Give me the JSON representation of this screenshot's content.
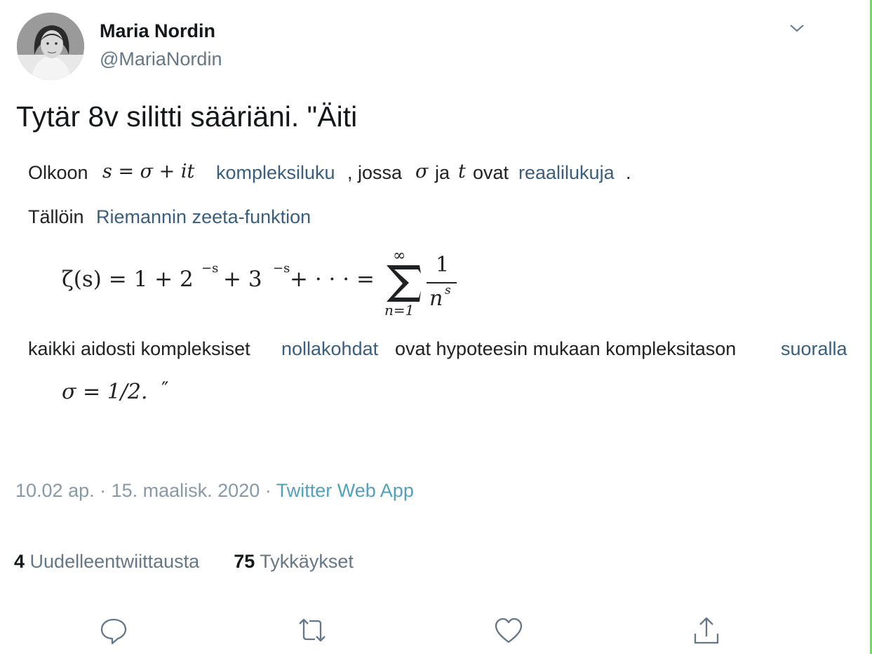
{
  "author": {
    "name": "Maria Nordin",
    "handle": "@MariaNordin"
  },
  "tweet": {
    "text": "Tytär 8v silitti sääriäni. \"Äiti"
  },
  "image": {
    "line1": {
      "olkoon": "Olkoon",
      "s_eq": "s = σ + it",
      "link_kompleksiluku": "kompleksiluku",
      "jossa": ", jossa",
      "sigma": "σ",
      "ja": "ja",
      "t": "t",
      "ovat": "ovat",
      "link_reaalilukuja": "reaalilukuja",
      "period": "."
    },
    "line2": {
      "tallion": "Tällöin",
      "link_zeta": "Riemannin zeeta-funktion"
    },
    "formula": {
      "lhs": "ζ(s) = 1 + 2",
      "exp1": "−s",
      "plus3": " + 3",
      "exp2": "−s",
      "dots": " + · · · =",
      "sum_top": "∞",
      "sum_bottom": "n=1",
      "frac_num": "1",
      "frac_den": "n",
      "frac_den_exp": "s"
    },
    "line3": {
      "kaikki": "kaikki aidosti kompleksiset",
      "link_nollakohdat": "nollakohdat",
      "ovat": "ovat hypoteesin mukaan kompleksitason",
      "link_suoralla": "suoralla"
    },
    "line4": {
      "sigma_eq": "σ = 1/2.",
      "quote": "″"
    }
  },
  "meta": {
    "time": "10.02 ap.",
    "sep": " · ",
    "date": "15. maalisk. 2020",
    "source": "Twitter Web App"
  },
  "stats": {
    "retweets_count": "4",
    "retweets_label": "Uudelleentwiittausta",
    "likes_count": "75",
    "likes_label": "Tykkäykset"
  },
  "icons": [
    "chevron-down-icon",
    "reply-icon",
    "retweet-icon",
    "like-icon",
    "share-icon"
  ],
  "colors": {
    "link": "#3b5e7c",
    "source_link": "#52a0b9",
    "meta": "#8899a6",
    "handle": "#657786"
  }
}
